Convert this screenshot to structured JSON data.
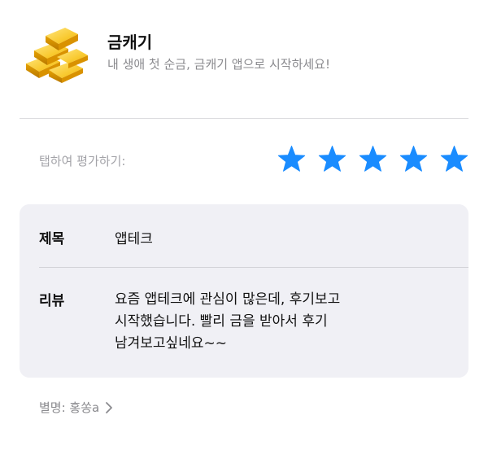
{
  "app": {
    "name": "금캐기",
    "tagline": "내 생애 첫 순금, 금캐기 앱으로 시작하세요!",
    "icon": "gold-bars-icon"
  },
  "rating": {
    "label": "탭하여 평가하기:",
    "max": 5,
    "value": 5,
    "star_color": "#1a8cff",
    "star_icon": "star-icon"
  },
  "review": {
    "title_label": "제목",
    "title_value": "앱테크",
    "body_label": "리뷰",
    "body_lines": [
      "요즘 앱테크에 관심이 많은데, 후기보고",
      "시작했습니다. 빨리 금을 받아서 후기",
      "남겨보고싶네요~~"
    ]
  },
  "nickname": {
    "label": "별명: 홍쏭a",
    "icon": "chevron-right-icon"
  }
}
